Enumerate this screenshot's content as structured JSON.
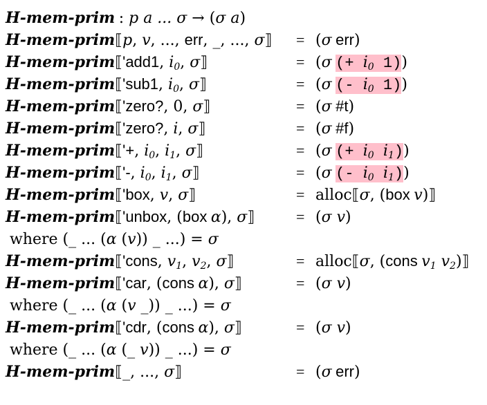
{
  "rows": [
    {
      "kind": "signature",
      "text": "H-mem-prim : p a ... σ → (σ a)"
    },
    {
      "kind": "rule",
      "lhs": "H-mem-prim⟦p, v, ..., err, _, ..., σ⟧",
      "rhs": "(σ err)"
    },
    {
      "kind": "rule",
      "lhs": "H-mem-prim⟦'add1, i0, σ⟧",
      "rhs": "(σ (+ i0 1))"
    },
    {
      "kind": "rule",
      "lhs": "H-mem-prim⟦'sub1, i0, σ⟧",
      "rhs": "(σ (- i0 1))"
    },
    {
      "kind": "rule",
      "lhs": "H-mem-prim⟦'zero?, 0, σ⟧",
      "rhs": "(σ #t)"
    },
    {
      "kind": "rule",
      "lhs": "H-mem-prim⟦'zero?, i, σ⟧",
      "rhs": "(σ #f)"
    },
    {
      "kind": "rule",
      "lhs": "H-mem-prim⟦'+, i0, i1, σ⟧",
      "rhs": "(σ (+ i0 i1))"
    },
    {
      "kind": "rule",
      "lhs": "H-mem-prim⟦'-, i0, i1, σ⟧",
      "rhs": "(σ (- i0 i1))"
    },
    {
      "kind": "rule",
      "lhs": "H-mem-prim⟦'box, v, σ⟧",
      "rhs": "alloc⟦σ, (box v)⟧"
    },
    {
      "kind": "rule",
      "lhs": "H-mem-prim⟦'unbox, (box α), σ⟧",
      "rhs": "(σ v)"
    },
    {
      "kind": "where",
      "text": "where (_ ... (α (v)) _ ...) = σ"
    },
    {
      "kind": "rule",
      "lhs": "H-mem-prim⟦'cons, v1, v2, σ⟧",
      "rhs": "alloc⟦σ, (cons v1 v2)⟧"
    },
    {
      "kind": "rule",
      "lhs": "H-mem-prim⟦'car, (cons α), σ⟧",
      "rhs": "(σ v)"
    },
    {
      "kind": "where",
      "text": "where (_ ... (α (v _)) _ ...) = σ"
    },
    {
      "kind": "rule",
      "lhs": "H-mem-prim⟦'cdr, (cons α), σ⟧",
      "rhs": "(σ v)"
    },
    {
      "kind": "where",
      "text": "where (_ ... (α (_ v)) _ ...) = σ"
    },
    {
      "kind": "rule",
      "lhs": "H-mem-prim⟦_, ..., σ⟧",
      "rhs": "(σ err)"
    }
  ],
  "eq_sign": "=",
  "highlight_color": "#ffbfcb"
}
